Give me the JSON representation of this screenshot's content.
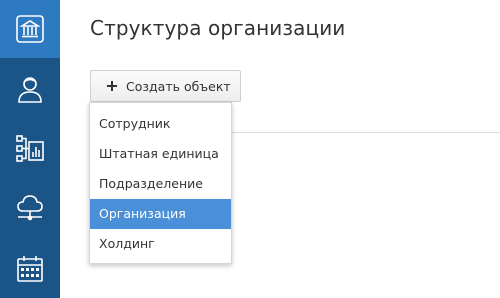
{
  "sidebar": {
    "items": [
      {
        "icon": "building-icon",
        "active": true
      },
      {
        "icon": "user-icon",
        "active": false
      },
      {
        "icon": "org-chart-icon",
        "active": false
      },
      {
        "icon": "cloud-network-icon",
        "active": false
      },
      {
        "icon": "calendar-icon",
        "active": false
      }
    ]
  },
  "page": {
    "title": "Структура организации",
    "create_button_label": "Создать объект"
  },
  "dropdown": {
    "items": [
      "Сотрудник",
      "Штатная единица",
      "Подразделение",
      "Организация",
      "Холдинг"
    ],
    "highlighted": "Организация"
  },
  "colors": {
    "sidebar": "#1b5486",
    "sidebar_active": "#2e7ac1",
    "highlight": "#4a90d9"
  }
}
